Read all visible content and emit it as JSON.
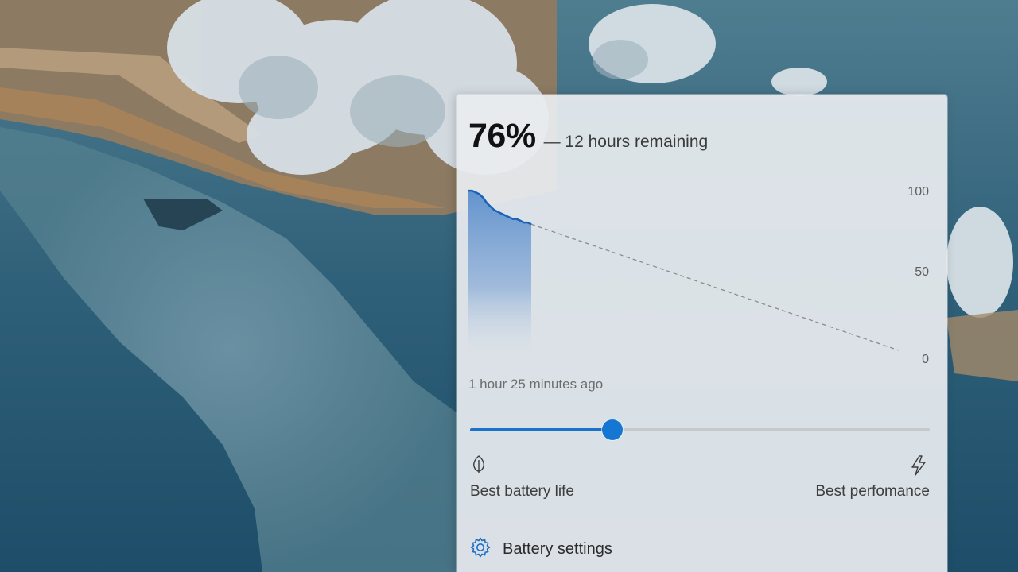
{
  "battery": {
    "percent_label": "76%",
    "remaining_label": "— 12 hours remaining"
  },
  "chart_data": {
    "type": "area",
    "y_ticks": [
      "100",
      "50",
      "0"
    ],
    "ylim": [
      0,
      100
    ],
    "history_label": "1 hour 25 minutes ago",
    "history_series": {
      "x_minutes": [
        -85,
        -80,
        -75,
        -70,
        -65,
        -60,
        -55,
        -50,
        -45,
        -40,
        -35,
        -30,
        -25,
        -20,
        -15,
        -10,
        -5,
        0
      ],
      "values": [
        95,
        95,
        94,
        93,
        91,
        88,
        86,
        84,
        83,
        82,
        81,
        80,
        79,
        79,
        78,
        77,
        77,
        76
      ]
    },
    "projection": {
      "from_value": 76,
      "to_value": 0,
      "style": "dashed"
    },
    "colors": {
      "line": "#1a62b5",
      "fill": "#5b8fcc",
      "projection": "#8a8d90",
      "tick_text": "#5f5f5f"
    }
  },
  "power_mode": {
    "slider_value_percent": 31,
    "left_label": "Best battery life",
    "right_label": "Best perfomance",
    "left_icon": "leaf-icon",
    "right_icon": "lightning-bolt-icon",
    "accent_color": "#1677d2"
  },
  "settings_link": {
    "icon": "gear-icon",
    "label": "Battery settings"
  }
}
